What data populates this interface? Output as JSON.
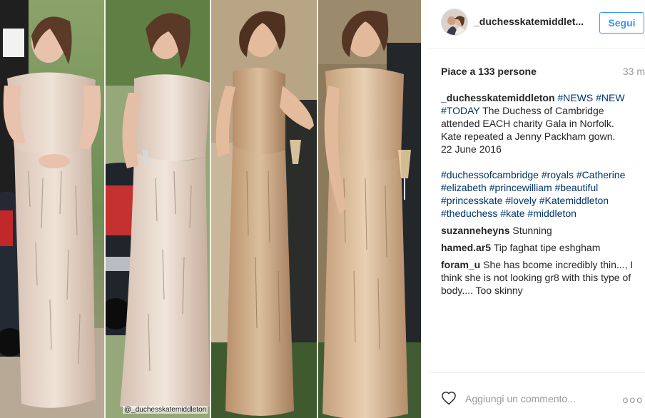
{
  "post": {
    "photo_alt": "Kate Middleton in a sequined Jenny Packham gown, four photos",
    "watermark": "@_duchesskatemiddleton"
  },
  "header": {
    "username": "_duchesskatemiddlet...",
    "follow_label": "Segui"
  },
  "stats": {
    "likes": "Piace a 133 persone",
    "time": "33 m"
  },
  "caption": {
    "username": "_duchesskatemiddleton",
    "lines": [
      [
        "#NEWS",
        "#NEW"
      ],
      [
        "#TODAY",
        "The Duchess of Cambridge"
      ],
      [
        "attended EACH charity Gala in Norfolk."
      ],
      [
        "Kate repeated a Jenny Packham gown."
      ],
      [
        "22 June 2016"
      ]
    ],
    "hashtag_lines": [
      "#duchessofcambridge #royals #Catherine",
      "#elizabeth #princewilliam #beautiful",
      "#princesskate #lovely #Katemiddleton",
      "#theduchess #kate #middleton"
    ]
  },
  "comments": [
    {
      "username": "suzanneheyns",
      "text": "Stunning"
    },
    {
      "username": "hamed.ar5",
      "text": "Tip faghat tipe eshgham"
    },
    {
      "username": "foram_u",
      "text": "She has bcome incredibly thin..., I think she is not looking gr8 with this type of body.... Too skinny"
    }
  ],
  "footer": {
    "add_comment_placeholder": "Aggiungi un commento...",
    "more_label": "ooo"
  },
  "colors": {
    "accent": "#3897f0",
    "hashtag": "#003569",
    "muted": "#999999"
  },
  "icons": [
    "heart-icon",
    "more-options-icon",
    "avatar"
  ]
}
